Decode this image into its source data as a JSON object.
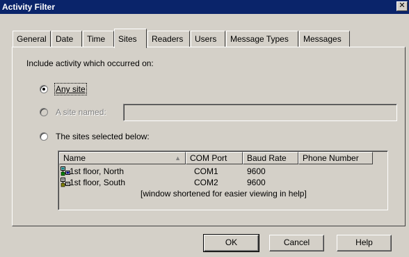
{
  "window": {
    "title": "Activity Filter",
    "close_glyph": "✕"
  },
  "tabs": [
    {
      "label": "General",
      "active": false
    },
    {
      "label": "Date",
      "active": false
    },
    {
      "label": "Time",
      "active": false
    },
    {
      "label": "Sites",
      "active": true
    },
    {
      "label": "Readers",
      "active": false
    },
    {
      "label": "Users",
      "active": false
    },
    {
      "label": "Message Types",
      "active": false
    },
    {
      "label": "Messages",
      "active": false
    }
  ],
  "sites_panel": {
    "intro": "Include activity which occurred on:",
    "options": {
      "any_site": {
        "label": "Any site",
        "checked": true
      },
      "site_named": {
        "label": "A site named:",
        "disabled": true,
        "value": ""
      },
      "selected_below": {
        "label": "The sites selected below:",
        "checked": false
      }
    },
    "list": {
      "columns": [
        "Name",
        "COM Port",
        "Baud Rate",
        "Phone Number"
      ],
      "sort_glyph": "▲",
      "rows": [
        {
          "name": "1st floor, North",
          "com_port": "COM1",
          "baud_rate": "9600",
          "phone": "",
          "icon": "site-network-icon"
        },
        {
          "name": "1st floor, South",
          "com_port": "COM2",
          "baud_rate": "9600",
          "phone": "",
          "icon": "site-network-icon"
        }
      ],
      "note": "[window shortened for easier viewing in help]"
    }
  },
  "buttons": {
    "ok": "OK",
    "cancel": "Cancel",
    "help": "Help"
  },
  "colors": {
    "titlebar": "#0a246a",
    "face": "#d4d0c8",
    "disabled_text": "#808080"
  }
}
